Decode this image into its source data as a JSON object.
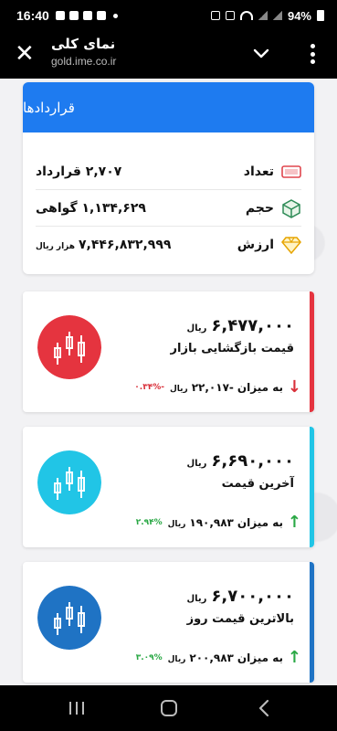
{
  "status_bar": {
    "time": "16:40",
    "battery": "94%"
  },
  "browser": {
    "title": "نمای کلی",
    "url": "gold.ime.co.ir"
  },
  "contracts": {
    "title": "قراردادها",
    "rows": [
      {
        "label": "تعداد",
        "value": "۲,۷۰۷ قرارداد",
        "unit": "",
        "icon": "trophy-count-icon"
      },
      {
        "label": "حجم",
        "value": "۱,۱۳۴,۶۲۹ گواهی",
        "unit": "",
        "icon": "cube-icon"
      },
      {
        "label": "ارزش",
        "value": "۷,۴۴۶,۸۳۲,۹۹۹",
        "unit": "هزار ریال",
        "icon": "diamond-icon"
      }
    ]
  },
  "cards": [
    {
      "price": "۶,۴۷۷,۰۰۰",
      "currency": "ریال",
      "name": "قیمت بازگشایی بازار",
      "change_prefix": "به میزان",
      "change_amount": "-۲۲,۰۱۷",
      "change_currency": "ریال",
      "change_pct": "-۰.۳۴%",
      "direction": "down",
      "accent": "#e5343f",
      "icon": "candlestick-chart-icon"
    },
    {
      "price": "۶,۶۹۰,۰۰۰",
      "currency": "ریال",
      "name": "آخرین قیمت",
      "change_prefix": "به میزان",
      "change_amount": "۱۹۰,۹۸۳",
      "change_currency": "ریال",
      "change_pct": "۲.۹۴%",
      "direction": "up",
      "accent": "#21c5e6",
      "icon": "candlestick-chart-icon"
    },
    {
      "price": "۶,۷۰۰,۰۰۰",
      "currency": "ریال",
      "name": "بالاترین قیمت روز",
      "change_prefix": "به میزان",
      "change_amount": "۲۰۰,۹۸۳",
      "change_currency": "ریال",
      "change_pct": "۳.۰۹%",
      "direction": "up",
      "accent": "#1f73c4",
      "icon": "candlestick-chart-icon"
    }
  ],
  "colors": {
    "blue_header": "#1e7bf0",
    "down": "#d9303a",
    "up": "#2aa845"
  },
  "arrows": {
    "up": "↑",
    "down": "↓"
  }
}
